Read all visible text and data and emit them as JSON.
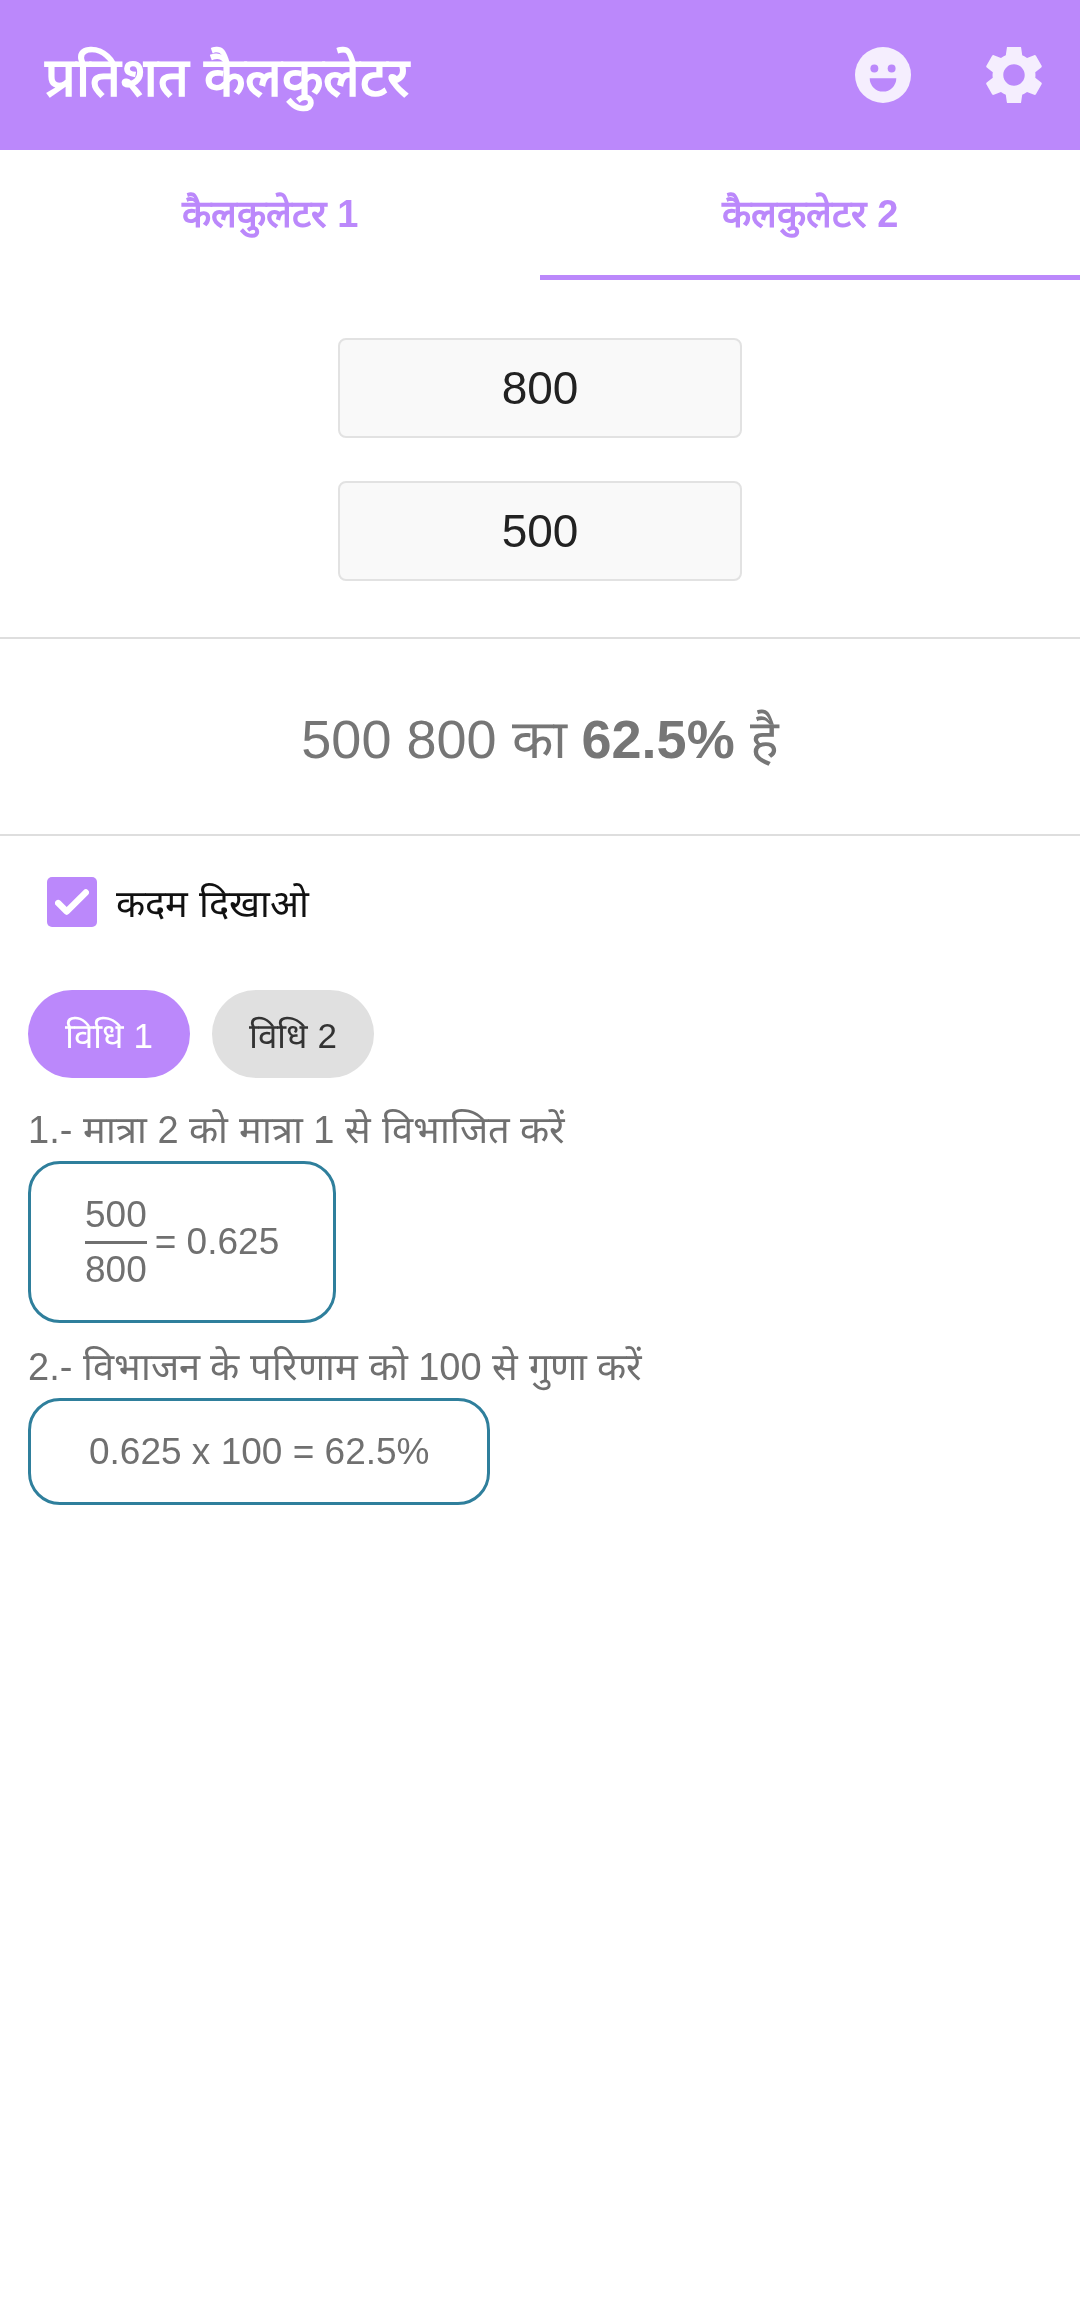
{
  "app_bar": {
    "title": "प्रतिशत कैलकुलेटर"
  },
  "tabs": [
    {
      "label": "कैलकुलेटर 1",
      "selected": false
    },
    {
      "label": "कैलकुलेटर 2",
      "selected": true
    }
  ],
  "inputs": [
    {
      "value": "800"
    },
    {
      "value": "500"
    }
  ],
  "result": {
    "text": "500 800 का **62.5%** है"
  },
  "show_steps": {
    "label": "कदम दिखाओ",
    "checked": true
  },
  "methods": [
    {
      "label": "विधि 1",
      "selected": true
    },
    {
      "label": "विधि 2",
      "selected": false
    }
  ],
  "steps": [
    {
      "kind": "fraction",
      "instruction": "1.- मात्रा 2 को मात्रा 1 से विभाजित करें",
      "numerator": "500",
      "denominator": "800",
      "result": "= 0.625"
    },
    {
      "kind": "expression",
      "instruction": "2.- विभाजन के परिणाम को 100 से गुणा करें",
      "expression": "0.625 x 100 = 62.5%"
    }
  ]
}
